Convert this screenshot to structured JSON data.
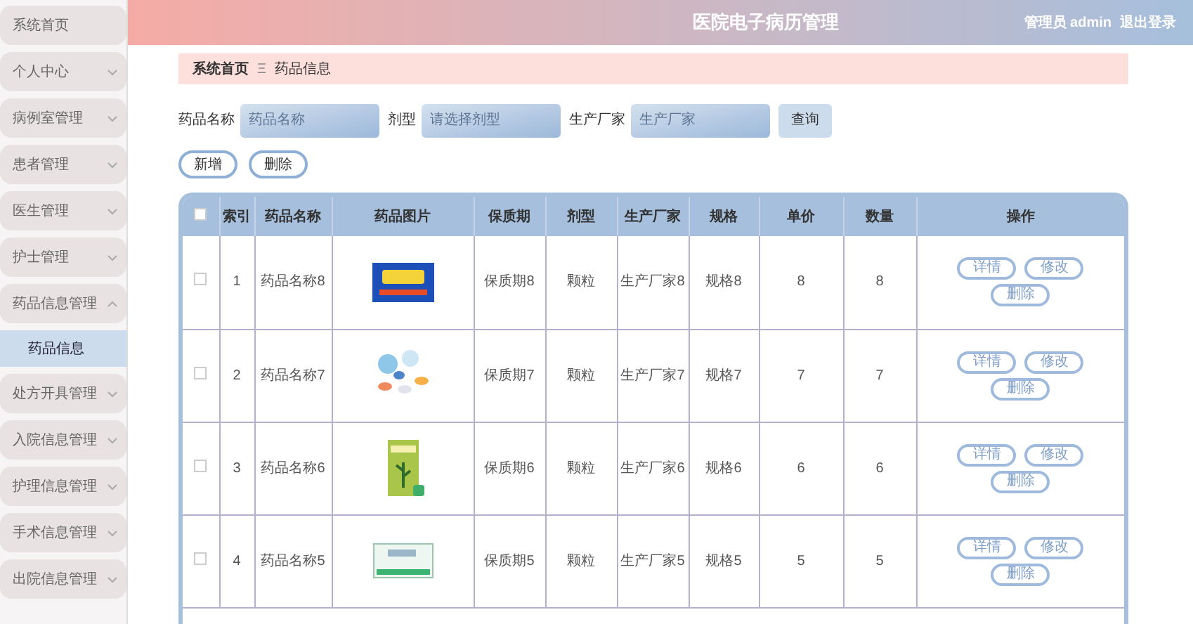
{
  "sidebar": {
    "items": [
      {
        "label": "系统首页",
        "kind": "link"
      },
      {
        "label": "个人中心",
        "kind": "menu",
        "expanded": false
      },
      {
        "label": "病例室管理",
        "kind": "menu",
        "expanded": false
      },
      {
        "label": "患者管理",
        "kind": "menu",
        "expanded": false
      },
      {
        "label": "医生管理",
        "kind": "menu",
        "expanded": false
      },
      {
        "label": "护士管理",
        "kind": "menu",
        "expanded": false
      },
      {
        "label": "药品信息管理",
        "kind": "menu",
        "expanded": true,
        "children": [
          {
            "label": "药品信息",
            "selected": true
          }
        ]
      },
      {
        "label": "处方开具管理",
        "kind": "menu",
        "expanded": false
      },
      {
        "label": "入院信息管理",
        "kind": "menu",
        "expanded": false
      },
      {
        "label": "护理信息管理",
        "kind": "menu",
        "expanded": false
      },
      {
        "label": "手术信息管理",
        "kind": "menu",
        "expanded": false
      },
      {
        "label": "出院信息管理",
        "kind": "menu",
        "expanded": false
      }
    ]
  },
  "header": {
    "title": "医院电子病历管理",
    "user": "管理员 admin",
    "logout": "退出登录"
  },
  "breadcrumb": [
    "系统首页",
    "药品信息"
  ],
  "breadcrumb_separator": "Ξ",
  "search": {
    "fields": [
      {
        "label": "药品名称",
        "placeholder": "药品名称"
      },
      {
        "label": "剂型",
        "placeholder": "请选择剂型"
      },
      {
        "label": "生产厂家",
        "placeholder": "生产厂家"
      }
    ],
    "button": "查询"
  },
  "actions": [
    "新增",
    "删除"
  ],
  "table": {
    "columns": [
      {
        "kind": "checkbox",
        "checked": false
      },
      {
        "kind": "text",
        "label": "索引"
      },
      {
        "kind": "text",
        "label": "药品名称"
      },
      {
        "kind": "text",
        "label": "药品图片"
      },
      {
        "kind": "text",
        "label": "保质期"
      },
      {
        "kind": "text",
        "label": "剂型"
      },
      {
        "kind": "text",
        "label": "生产厂家"
      },
      {
        "kind": "text",
        "label": "规格"
      },
      {
        "kind": "text",
        "label": "单价"
      },
      {
        "kind": "text",
        "label": "数量"
      },
      {
        "kind": "text",
        "label": "操作"
      }
    ],
    "rows": [
      {
        "cells": [
          {
            "kind": "checkbox",
            "checked": false
          },
          {
            "kind": "text",
            "text": "1"
          },
          {
            "kind": "text",
            "text": "药品名称8"
          },
          {
            "kind": "picture"
          },
          {
            "kind": "text",
            "text": "保质期8"
          },
          {
            "kind": "text",
            "text": "颗粒"
          },
          {
            "kind": "text",
            "text": "生产厂家8"
          },
          {
            "kind": "text",
            "text": "规格8"
          },
          {
            "kind": "text",
            "text": "8"
          },
          {
            "kind": "text",
            "text": "8"
          },
          {
            "kind": "actions",
            "actions": [
              "详情",
              "修改",
              "删除"
            ]
          }
        ]
      },
      {
        "cells": [
          {
            "kind": "checkbox",
            "checked": false
          },
          {
            "kind": "text",
            "text": "2"
          },
          {
            "kind": "text",
            "text": "药品名称7"
          },
          {
            "kind": "picture"
          },
          {
            "kind": "text",
            "text": "保质期7"
          },
          {
            "kind": "text",
            "text": "颗粒"
          },
          {
            "kind": "text",
            "text": "生产厂家7"
          },
          {
            "kind": "text",
            "text": "规格7"
          },
          {
            "kind": "text",
            "text": "7"
          },
          {
            "kind": "text",
            "text": "7"
          },
          {
            "kind": "actions",
            "actions": [
              "详情",
              "修改",
              "删除"
            ]
          }
        ]
      },
      {
        "cells": [
          {
            "kind": "checkbox",
            "checked": false
          },
          {
            "kind": "text",
            "text": "3"
          },
          {
            "kind": "text",
            "text": "药品名称6"
          },
          {
            "kind": "picture"
          },
          {
            "kind": "text",
            "text": "保质期6"
          },
          {
            "kind": "text",
            "text": "颗粒"
          },
          {
            "kind": "text",
            "text": "生产厂家6"
          },
          {
            "kind": "text",
            "text": "规格6"
          },
          {
            "kind": "text",
            "text": "6"
          },
          {
            "kind": "text",
            "text": "6"
          },
          {
            "kind": "actions",
            "actions": [
              "详情",
              "修改",
              "删除"
            ]
          }
        ]
      },
      {
        "cells": [
          {
            "kind": "checkbox",
            "checked": false
          },
          {
            "kind": "text",
            "text": "4"
          },
          {
            "kind": "text",
            "text": "药品名称5"
          },
          {
            "kind": "picture"
          },
          {
            "kind": "text",
            "text": "保质期5"
          },
          {
            "kind": "text",
            "text": "颗粒"
          },
          {
            "kind": "text",
            "text": "生产厂家5"
          },
          {
            "kind": "text",
            "text": "规格5"
          },
          {
            "kind": "text",
            "text": "5"
          },
          {
            "kind": "text",
            "text": "5"
          },
          {
            "kind": "actions",
            "actions": [
              "详情",
              "修改",
              "删除"
            ]
          }
        ]
      }
    ]
  }
}
